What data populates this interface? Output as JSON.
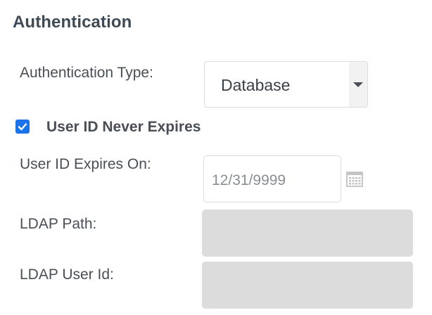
{
  "section": {
    "title": "Authentication"
  },
  "auth_type": {
    "label": "Authentication Type:",
    "selected": "Database"
  },
  "never_expires": {
    "label": "User ID Never Expires",
    "checked": true
  },
  "expires_on": {
    "label": "User ID Expires On:",
    "value": "12/31/9999",
    "icon": "calendar-icon"
  },
  "ldap_path": {
    "label": "LDAP Path:",
    "value": ""
  },
  "ldap_user_id": {
    "label": "LDAP User Id:",
    "value": ""
  },
  "colors": {
    "checkbox_accent": "#1a73e8",
    "disabled_field": "#dcdcdc",
    "title": "#3f4a57"
  }
}
